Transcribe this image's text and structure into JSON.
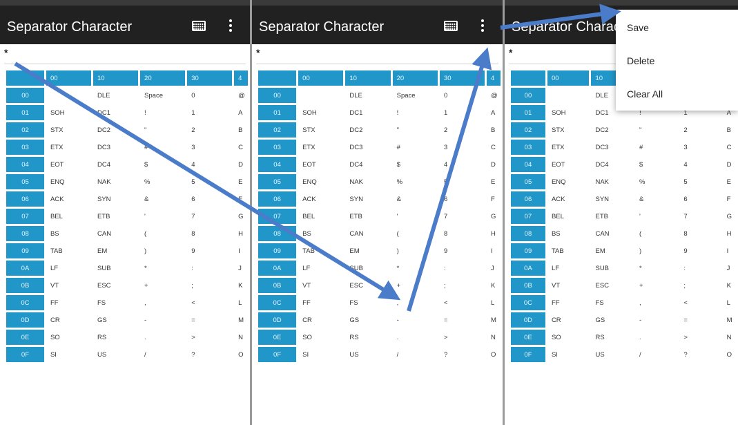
{
  "panels": [
    {
      "title": "Separator Character",
      "input_value": "*"
    },
    {
      "title": "Separator Character",
      "input_value": "*"
    },
    {
      "title": "Separator Character",
      "input_value": "*"
    }
  ],
  "column_headers": [
    "",
    "00",
    "10",
    "20",
    "30",
    "4"
  ],
  "rows": [
    {
      "code": "00",
      "c1": "",
      "c2": "DLE",
      "c3": "Space",
      "c4": "0",
      "c5": "@"
    },
    {
      "code": "01",
      "c1": "SOH",
      "c2": "DC1",
      "c3": "!",
      "c4": "1",
      "c5": "A"
    },
    {
      "code": "02",
      "c1": "STX",
      "c2": "DC2",
      "c3": "\"",
      "c4": "2",
      "c5": "B"
    },
    {
      "code": "03",
      "c1": "ETX",
      "c2": "DC3",
      "c3": "#",
      "c4": "3",
      "c5": "C"
    },
    {
      "code": "04",
      "c1": "EOT",
      "c2": "DC4",
      "c3": "$",
      "c4": "4",
      "c5": "D"
    },
    {
      "code": "05",
      "c1": "ENQ",
      "c2": "NAK",
      "c3": "%",
      "c4": "5",
      "c5": "E"
    },
    {
      "code": "06",
      "c1": "ACK",
      "c2": "SYN",
      "c3": "&",
      "c4": "6",
      "c5": "F"
    },
    {
      "code": "07",
      "c1": "BEL",
      "c2": "ETB",
      "c3": "'",
      "c4": "7",
      "c5": "G"
    },
    {
      "code": "08",
      "c1": "BS",
      "c2": "CAN",
      "c3": "(",
      "c4": "8",
      "c5": "H"
    },
    {
      "code": "09",
      "c1": "TAB",
      "c2": "EM",
      "c3": ")",
      "c4": "9",
      "c5": "I"
    },
    {
      "code": "0A",
      "c1": "LF",
      "c2": "SUB",
      "c3": "*",
      "c4": ":",
      "c5": "J"
    },
    {
      "code": "0B",
      "c1": "VT",
      "c2": "ESC",
      "c3": "+",
      "c4": ";",
      "c5": "K"
    },
    {
      "code": "0C",
      "c1": "FF",
      "c2": "FS",
      "c3": ",",
      "c4": "<",
      "c5": "L"
    },
    {
      "code": "0D",
      "c1": "CR",
      "c2": "GS",
      "c3": "-",
      "c4": "=",
      "c5": "M"
    },
    {
      "code": "0E",
      "c1": "SO",
      "c2": "RS",
      "c3": ".",
      "c4": ">",
      "c5": "N"
    },
    {
      "code": "0F",
      "c1": "SI",
      "c2": "US",
      "c3": "/",
      "c4": "?",
      "c5": "O"
    }
  ],
  "menu": {
    "items": [
      "Save",
      "Delete",
      "Clear All"
    ]
  },
  "colors": {
    "appbar": "#212121",
    "cell_accent": "#2196c8",
    "annotation_arrow": "#4a7cc9"
  },
  "icons": {
    "keyboard": "keyboard-icon",
    "overflow": "more-vert-icon"
  }
}
